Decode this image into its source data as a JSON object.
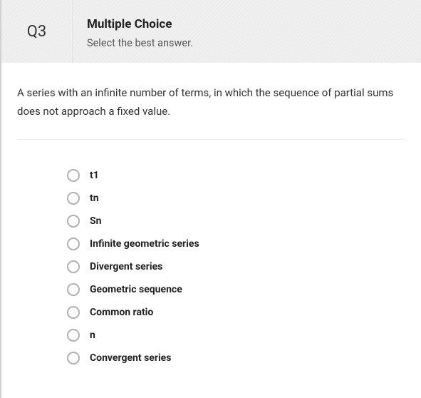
{
  "header": {
    "number": "Q3",
    "type": "Multiple Choice",
    "instruction": "Select the best answer."
  },
  "question": {
    "text": "A series with an infinite number of terms, in which the sequence of partial sums does not approach a fixed value."
  },
  "options": [
    {
      "label": "t1"
    },
    {
      "label": "tn"
    },
    {
      "label": "Sn"
    },
    {
      "label": "Infinite geometric series"
    },
    {
      "label": "Divergent series"
    },
    {
      "label": "Geometric sequence"
    },
    {
      "label": "Common ratio"
    },
    {
      "label": "n"
    },
    {
      "label": "Convergent series"
    }
  ]
}
